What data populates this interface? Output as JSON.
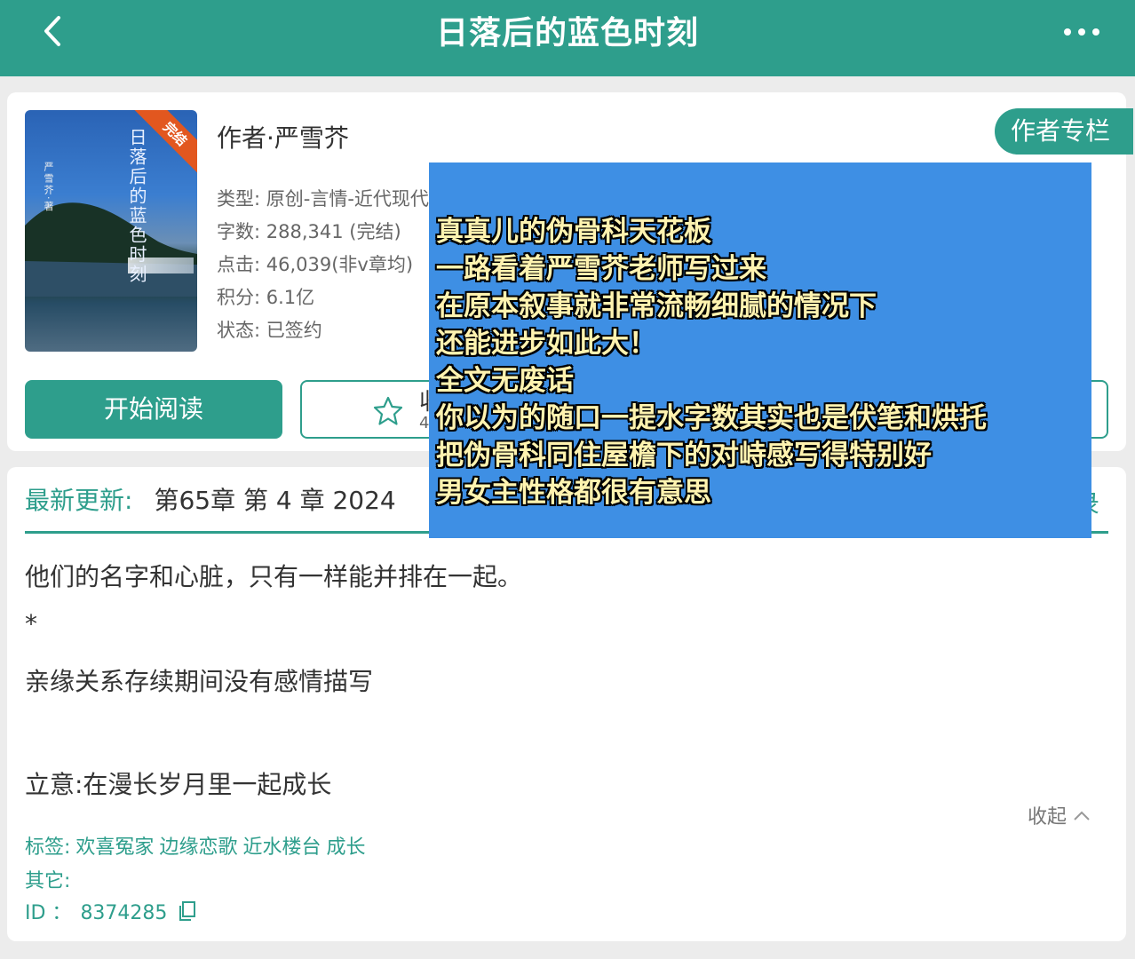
{
  "header": {
    "title": "日落后的蓝色时刻",
    "back_icon": "chevron-left-icon",
    "more_icon": "more-dots-icon"
  },
  "book": {
    "cover_title": "日落后的蓝色时刻",
    "cover_author": "严雪芥·著",
    "cover_badge": "完结",
    "author": "作者·严雪芥",
    "type": "类型: 原创-言情-近代现代",
    "words": "字数: 288,341 (完结)",
    "clicks": "点击: 46,039(非v章均)",
    "score": "积分: 6.1亿",
    "status": "状态: 已签约",
    "author_column_label": "作者专栏",
    "read_label": "开始阅读",
    "favorite_label": "收藏",
    "favorite_count": "4"
  },
  "update": {
    "label": "最新更新:",
    "chapter": "第65章  第 4 章  2024",
    "catalog_label": "目录"
  },
  "description": {
    "lines": [
      "他们的名字和心脏，只有一样能并排在一起。",
      "*",
      "亲缘关系存续期间没有感情描写",
      "立意:在漫长岁月里一起成长"
    ],
    "collapse_label": "收起"
  },
  "tags": {
    "label": "标签:",
    "items": [
      "欢喜冤家",
      "边缘恋歌",
      "近水楼台",
      "成长"
    ]
  },
  "other": {
    "label": "其它:"
  },
  "id": {
    "label": "ID  ：",
    "value": "8374285"
  },
  "overlay_note": {
    "lines": [
      "真真儿的伪骨科天花板",
      "一路看着严雪芥老师写过来",
      "在原本叙事就非常流畅细腻的情况下",
      "还能进步如此大！",
      "全文无废话",
      "你以为的随口一提水字数其实也是伏笔和烘托",
      "把伪骨科同住屋檐下的对峙感写得特别好",
      "男女主性格都很有意思"
    ]
  },
  "colors": {
    "accent": "#2e9e8c",
    "overlay_bg": "#3e8fe4",
    "ribbon": "#e2571f"
  }
}
